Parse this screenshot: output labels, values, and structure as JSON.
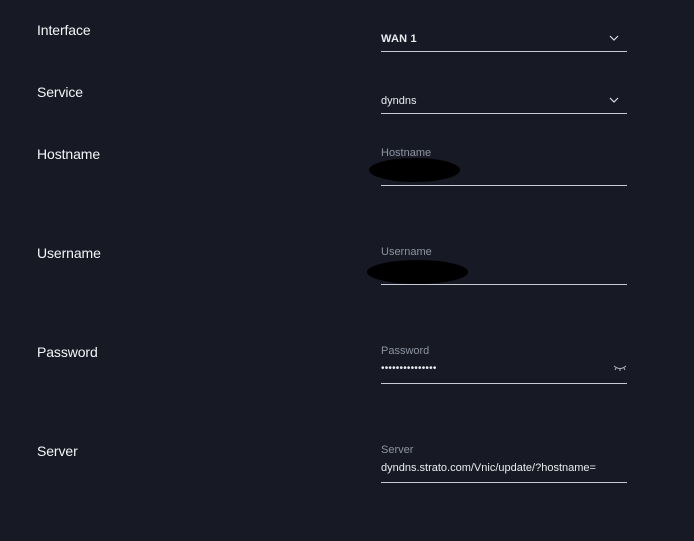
{
  "form": {
    "interface": {
      "label": "Interface",
      "value": "WAN 1"
    },
    "service": {
      "label": "Service",
      "value": "dyndns"
    },
    "hostname": {
      "label": "Hostname",
      "placeholder": "Hostname"
    },
    "username": {
      "label": "Username",
      "placeholder": "Username"
    },
    "password": {
      "label": "Password",
      "placeholder": "Password",
      "masked_value": "•••••••••••••••"
    },
    "server": {
      "label": "Server",
      "placeholder": "Server",
      "value": "dyndns.strato.com/Vnic/update/?hostname="
    }
  },
  "icons": {
    "select_chevron": "chevron-down-icon",
    "password_toggle": "eye-closed-icon"
  },
  "colors": {
    "background": "#171a25",
    "text": "#f1f3f5",
    "placeholder": "#8e93a1",
    "underline": "#c8cbd3"
  }
}
